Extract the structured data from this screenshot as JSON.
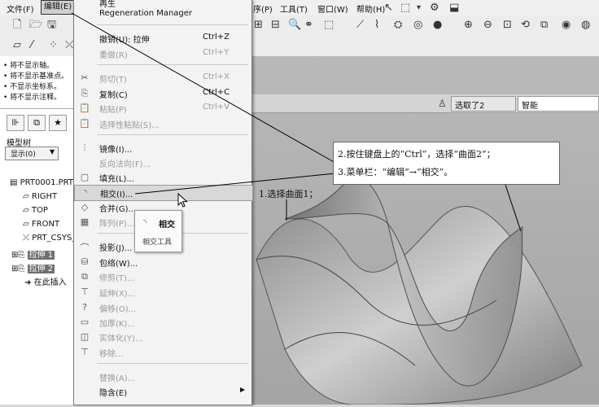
{
  "menubar": {
    "file": "文件(F)",
    "edit": "编辑(E)",
    "program": "序(P)",
    "tools": "工具(T)",
    "window": "窗口(W)",
    "help": "帮助(H)"
  },
  "left_pane": {
    "messages": [
      "• 将不显示轴。",
      "• 将不显示基准点。",
      "• 不显示坐标系。",
      "• 将不显示注释。"
    ],
    "model_tree_title": "模型树",
    "display_button": "显示(0)",
    "tree_items": [
      "PRT0001.PRT",
      "RIGHT",
      "TOP",
      "FRONT",
      "PRT_CSYS_",
      "拉伸 1",
      "拉伸 2",
      "在此插入"
    ]
  },
  "status": {
    "selected": "选取了2",
    "filter": "智能"
  },
  "edit_menu": {
    "regeneration": "Regeneration Manager",
    "undo": {
      "label": "撤销(U): 拉伸",
      "shortcut": "Ctrl+Z"
    },
    "redo": {
      "label": "重做(R)",
      "shortcut": "Ctrl+Y"
    },
    "cut": {
      "label": "剪切(T)",
      "shortcut": "Ctrl+X"
    },
    "copy": {
      "label": "复制(C)",
      "shortcut": "Ctrl+C"
    },
    "paste": {
      "label": "粘贴(P)",
      "shortcut": "Ctrl+V"
    },
    "paste_special": "选择性粘贴(S)...",
    "mirror": "镜像(I)...",
    "reverse_normal": "反向法向(F)...",
    "fill": "填充(L)...",
    "intersect": "相交(I)...",
    "merge": "合并(G)...",
    "pattern": "阵列(P)...",
    "project": "投影(J)...",
    "wrap": "包络(W)...",
    "trim": "修剪(T)...",
    "extend": "延伸(X)...",
    "offset": "偏移(O)...",
    "thicken": "加厚(K)...",
    "solidify": "实体化(Y)...",
    "remove": "移除...",
    "replace": "替换(A)...",
    "hide": "隐含(E)"
  },
  "tooltip": {
    "title": "相交",
    "subtitle": "相交工具"
  },
  "annotations": {
    "step1": "1.选择曲面1；",
    "step2": "2.按住键盘上的“Ctrl”，选择“曲面2”；",
    "step3": "3.菜单栏：“编辑”→“相交”。"
  },
  "colors": {
    "menu_highlight": "#d8d8d8",
    "tree_highlight": "#707070"
  }
}
